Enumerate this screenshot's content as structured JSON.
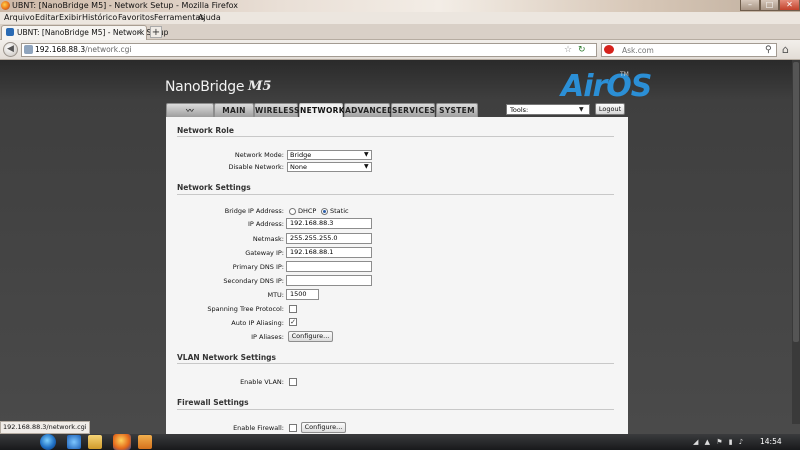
{
  "window": {
    "title": "UBNT: [NanoBridge M5] - Network Setup - Mozilla Firefox",
    "controls": {
      "minimize": "–",
      "maximize": "□",
      "close": "✕"
    }
  },
  "menubar": [
    "Arquivo",
    "Editar",
    "Exibir",
    "Histórico",
    "Favoritos",
    "Ferramentas",
    "Ajuda"
  ],
  "tab": {
    "label": "UBNT: [NanoBridge M5] - Network Setup",
    "close": "×",
    "new_tab": "+"
  },
  "nav": {
    "back": "◀",
    "url_host": "192.168.88.3",
    "url_path": "/network.cgi",
    "star": "☆",
    "reload": "↻",
    "search_placeholder": "Ask.com",
    "search_go": "⚲",
    "home": "⌂"
  },
  "header": {
    "brand": "NanoBridge",
    "model": "M5",
    "logo": "AirOS",
    "logo_tm": "TM"
  },
  "device_tabs": [
    {
      "label": "〰",
      "name": "logo"
    },
    {
      "label": "MAIN"
    },
    {
      "label": "WIRELESS"
    },
    {
      "label": "NETWORK",
      "active": true
    },
    {
      "label": "ADVANCED"
    },
    {
      "label": "SERVICES"
    },
    {
      "label": "SYSTEM"
    }
  ],
  "tools": {
    "label": "Tools:",
    "arrow": "▼",
    "logout": "Logout"
  },
  "sections": {
    "network_role": {
      "title": "Network Role",
      "network_mode": {
        "label": "Network Mode:",
        "value": "Bridge"
      },
      "disable_network": {
        "label": "Disable Network:",
        "value": "None"
      }
    },
    "network_settings": {
      "title": "Network Settings",
      "bridge_ip": {
        "label": "Bridge IP Address:",
        "options": [
          "DHCP",
          "Static"
        ],
        "selected": "Static"
      },
      "ip_address": {
        "label": "IP Address:",
        "value": "192.168.88.3"
      },
      "netmask": {
        "label": "Netmask:",
        "value": "255.255.255.0"
      },
      "gateway": {
        "label": "Gateway IP:",
        "value": "192.168.88.1"
      },
      "primary_dns": {
        "label": "Primary DNS IP:",
        "value": ""
      },
      "secondary_dns": {
        "label": "Secondary DNS IP:",
        "value": ""
      },
      "mtu": {
        "label": "MTU:",
        "value": "1500"
      },
      "stp": {
        "label": "Spanning Tree Protocol:",
        "checked": false
      },
      "auto_ip": {
        "label": "Auto IP Aliasing:",
        "checked": true,
        "mark": "✓"
      },
      "ip_aliases": {
        "label": "IP Aliases:",
        "button": "Configure..."
      }
    },
    "vlan": {
      "title": "VLAN Network Settings",
      "enable_vlan": {
        "label": "Enable VLAN:",
        "checked": false
      }
    },
    "firewall": {
      "title": "Firewall Settings",
      "enable_firewall": {
        "label": "Enable Firewall:",
        "checked": false,
        "button": "Configure..."
      }
    }
  },
  "statusbar": {
    "text": "192.168.88.3/network.cgi"
  },
  "taskbar": {
    "tray": "◢ ▲ ⚑ ▮ ♪",
    "clock": "14:54"
  }
}
